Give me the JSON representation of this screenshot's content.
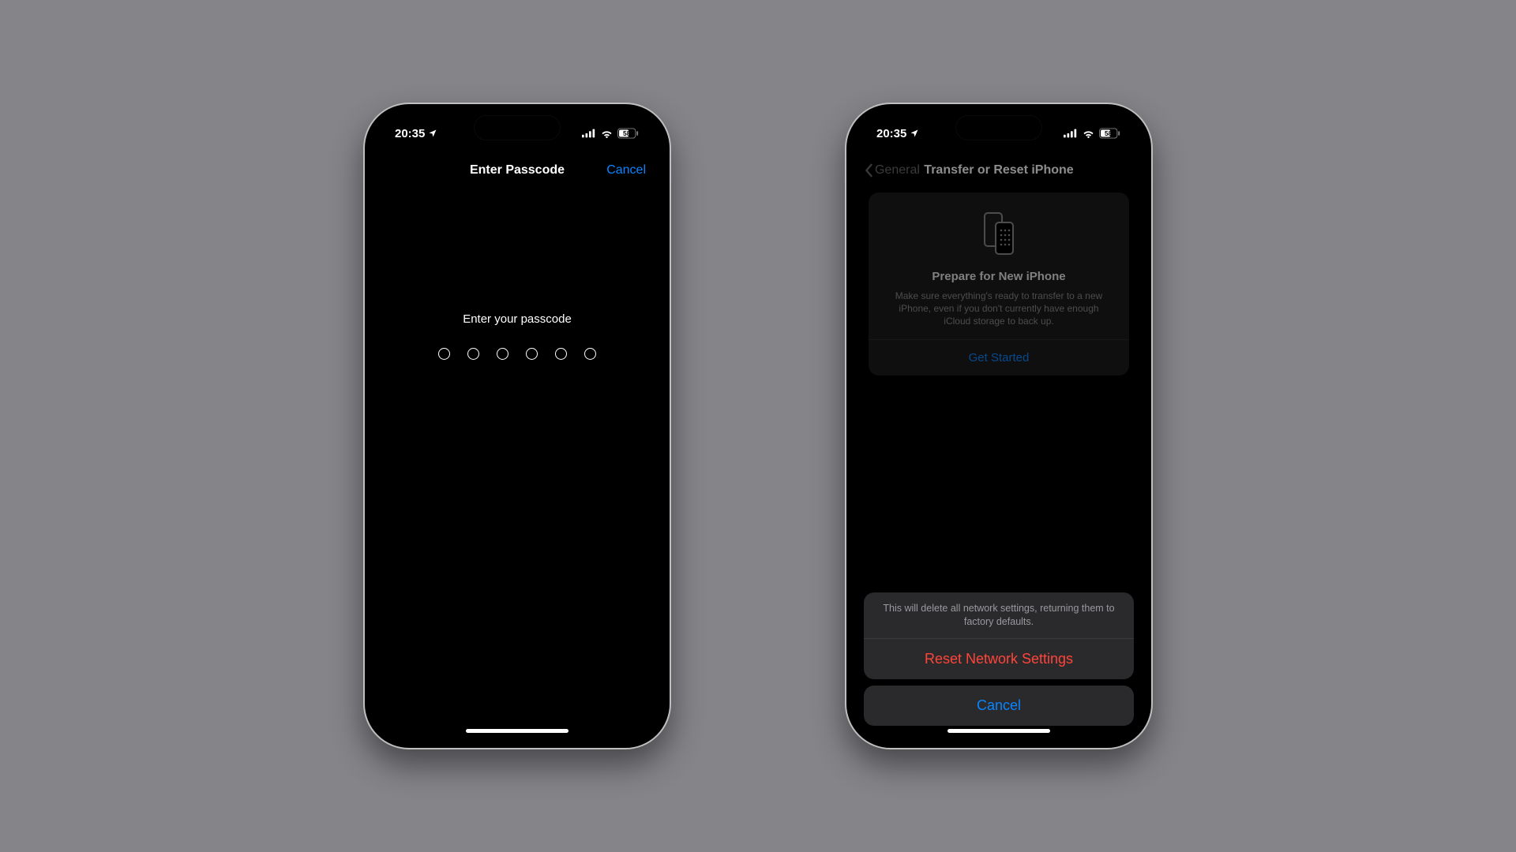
{
  "status": {
    "time": "20:35",
    "battery": "58"
  },
  "screen1": {
    "nav_title": "Enter Passcode",
    "nav_cancel": "Cancel",
    "prompt": "Enter your passcode"
  },
  "screen2": {
    "nav_back_label": "General",
    "nav_title": "Transfer or Reset iPhone",
    "prepare": {
      "title": "Prepare for New iPhone",
      "desc": "Make sure everything's ready to transfer to a new iPhone, even if you don't currently have enough iCloud storage to back up.",
      "cta": "Get Started"
    },
    "sheet": {
      "message": "This will delete all network settings, returning them to factory defaults.",
      "destructive": "Reset Network Settings",
      "cancel": "Cancel"
    }
  }
}
